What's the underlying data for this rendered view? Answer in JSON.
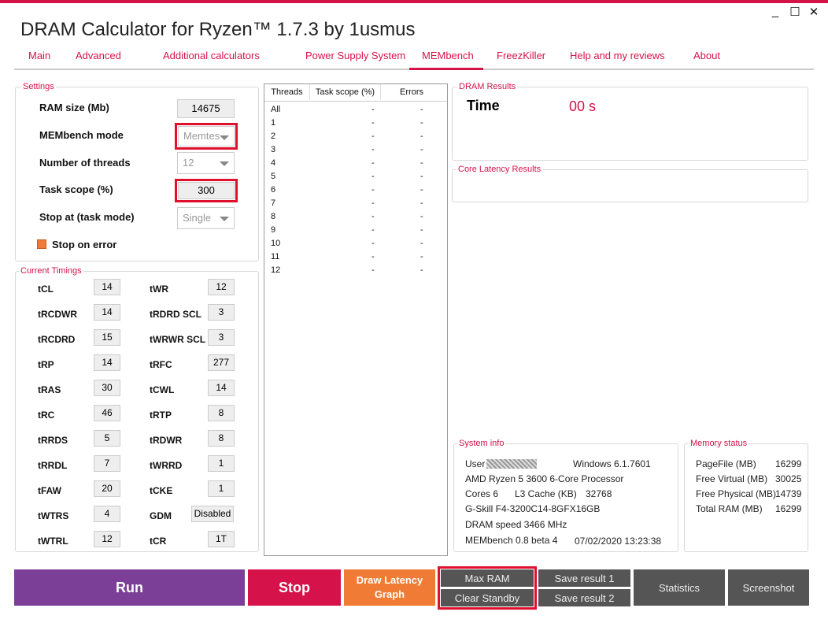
{
  "window": {
    "title": "DRAM Calculator for Ryzen™ 1.7.3 by 1usmus",
    "controls": [
      "_",
      "☐",
      "✕"
    ]
  },
  "tabs": [
    "Main",
    "Advanced",
    "Additional calculators",
    "Power Supply System",
    "MEMbench",
    "FreezKiller",
    "Help and my reviews",
    "About"
  ],
  "settings": {
    "title": "Settings",
    "ram_size_label": "RAM size (Mb)",
    "ram_size_value": "14675",
    "mode_label": "MEMbench mode",
    "mode_value": "Memtes",
    "threads_label": "Number of threads",
    "threads_value": "12",
    "task_scope_label": "Task scope (%)",
    "task_scope_value": "300",
    "stop_at_label": "Stop at (task mode)",
    "stop_at_value": "Single",
    "stop_on_error_label": "Stop on error"
  },
  "timings": {
    "title": "Current Timings",
    "left": [
      {
        "label": "tCL",
        "value": "14"
      },
      {
        "label": "tRCDWR",
        "value": "14"
      },
      {
        "label": "tRCDRD",
        "value": "15"
      },
      {
        "label": "tRP",
        "value": "14"
      },
      {
        "label": "tRAS",
        "value": "30"
      },
      {
        "label": "tRC",
        "value": "46"
      },
      {
        "label": "tRRDS",
        "value": "5"
      },
      {
        "label": "tRRDL",
        "value": "7"
      },
      {
        "label": "tFAW",
        "value": "20"
      },
      {
        "label": "tWTRS",
        "value": "4"
      },
      {
        "label": "tWTRL",
        "value": "12"
      }
    ],
    "right": [
      {
        "label": "tWR",
        "value": "12"
      },
      {
        "label": "tRDRD SCL",
        "value": "3"
      },
      {
        "label": "tWRWR SCL",
        "value": "3"
      },
      {
        "label": "tRFC",
        "value": "277"
      },
      {
        "label": "tCWL",
        "value": "14"
      },
      {
        "label": "tRTP",
        "value": "8"
      },
      {
        "label": "tRDWR",
        "value": "8"
      },
      {
        "label": "tWRRD",
        "value": "1"
      },
      {
        "label": "tCKE",
        "value": "1"
      },
      {
        "label": "GDM",
        "value": "Disabled"
      },
      {
        "label": "tCR",
        "value": "1T"
      }
    ]
  },
  "threads_grid": {
    "headers": [
      "Threads",
      "Task scope (%)",
      "Errors"
    ],
    "rows": [
      [
        "All",
        "-",
        "-"
      ],
      [
        "1",
        "-",
        "-"
      ],
      [
        "2",
        "-",
        "-"
      ],
      [
        "3",
        "-",
        "-"
      ],
      [
        "4",
        "-",
        "-"
      ],
      [
        "5",
        "-",
        "-"
      ],
      [
        "6",
        "-",
        "-"
      ],
      [
        "7",
        "-",
        "-"
      ],
      [
        "8",
        "-",
        "-"
      ],
      [
        "9",
        "-",
        "-"
      ],
      [
        "10",
        "-",
        "-"
      ],
      [
        "11",
        "-",
        "-"
      ],
      [
        "12",
        "-",
        "-"
      ]
    ]
  },
  "dram_results": {
    "title": "DRAM Results",
    "time_label": "Time",
    "time_value": "00 s"
  },
  "core_latency": {
    "title": "Core Latency Results"
  },
  "system_info": {
    "title": "System info",
    "user_label": "User",
    "os": "Windows 6.1.7601",
    "cpu": "AMD Ryzen 5 3600 6-Core Processor",
    "cores": "Cores 6",
    "l3_label": "L3 Cache (KB)",
    "l3_value": "32768",
    "memory": "G-Skill F4-3200C14-8GFX16GB",
    "dram_speed": "DRAM speed 3466 MHz",
    "version": "MEMbench 0.8 beta 4",
    "datetime": "07/02/2020 13:23:38"
  },
  "memory_status": {
    "title": "Memory status",
    "items": [
      {
        "label": "PageFile (MB)",
        "value": "16299"
      },
      {
        "label": "Free Virtual (MB)",
        "value": "30025"
      },
      {
        "label": "Free Physical (MB)",
        "value": "14739"
      },
      {
        "label": "Total RAM (MB)",
        "value": "16299"
      }
    ]
  },
  "buttons": {
    "run": "Run",
    "stop": "Stop",
    "draw_latency": "Draw Latency Graph",
    "max_ram": "Max RAM",
    "clear_standby": "Clear Standby",
    "save1": "Save result 1",
    "save2": "Save result 2",
    "statistics": "Statistics",
    "screenshot": "Screenshot"
  },
  "colors": {
    "accent": "#d6124a",
    "run": "#7b3f98",
    "stop": "#d6124a",
    "draw": "#f07b34",
    "dark_button": "#555555",
    "highlight_frame": "#e0102d"
  }
}
